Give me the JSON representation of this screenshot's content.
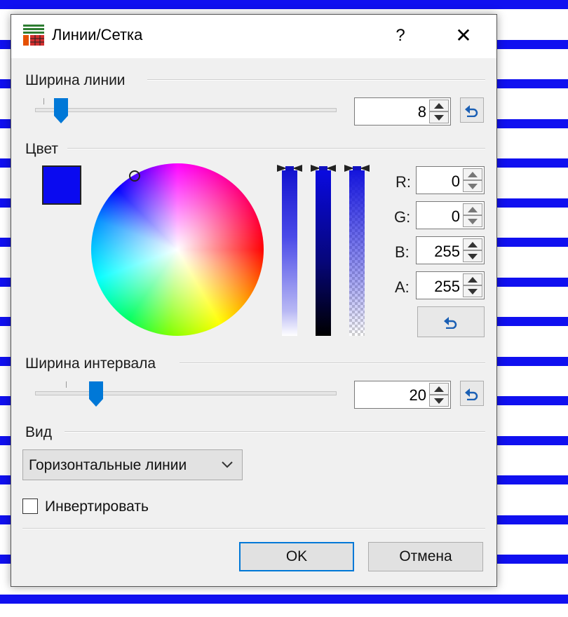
{
  "window": {
    "title": "Линии/Сетка",
    "help_label": "?",
    "close_label": "✕"
  },
  "line_width": {
    "label": "Ширина линии",
    "value": "8"
  },
  "color": {
    "label": "Цвет",
    "current_hex": "#0000FF",
    "channels": [
      {
        "label": "R:",
        "value": "0"
      },
      {
        "label": "G:",
        "value": "0"
      },
      {
        "label": "B:",
        "value": "255"
      },
      {
        "label": "A:",
        "value": "255"
      }
    ]
  },
  "interval_width": {
    "label": "Ширина интервала",
    "value": "20"
  },
  "view": {
    "label": "Вид",
    "selected": "Горизонтальные линии"
  },
  "invert": {
    "label": "Инвертировать",
    "checked": false
  },
  "buttons": {
    "ok": "OK",
    "cancel": "Отмена"
  },
  "colors": {
    "accent": "#0078D7",
    "stripe": "#1010F0"
  }
}
